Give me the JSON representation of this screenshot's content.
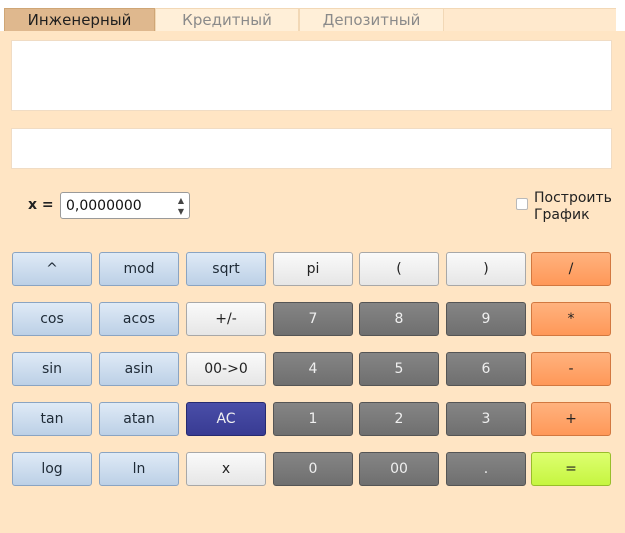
{
  "tabs": [
    {
      "label": "Инженерный",
      "active": true
    },
    {
      "label": "Кредитный",
      "active": false
    },
    {
      "label": "Депозитный",
      "active": false
    }
  ],
  "display": {
    "expression": "",
    "result": ""
  },
  "x_input": {
    "label": "x =",
    "value": "0,0000000"
  },
  "graph_checkbox": {
    "label_line1": "Построить",
    "label_line2": "График",
    "checked": false
  },
  "keys": [
    [
      "^",
      "mod",
      "sqrt",
      "pi",
      "(",
      ")",
      "/"
    ],
    [
      "cos",
      "acos",
      "+/-",
      "7",
      "8",
      "9",
      "*"
    ],
    [
      "sin",
      "asin",
      "00->0",
      "4",
      "5",
      "6",
      "-"
    ],
    [
      "tan",
      "atan",
      "AC",
      "1",
      "2",
      "3",
      "+"
    ],
    [
      "log",
      "ln",
      "x",
      "0",
      "00",
      ".",
      "="
    ]
  ],
  "colors": {
    "background": "#ffe5c4",
    "active_tab": "#dfb88e",
    "function_key": "#c8d8ec",
    "digit_key": "#7a7a7a",
    "operator_key": "#ff9e62",
    "clear_key": "#3a3d96",
    "equals_key": "#ccff4c"
  }
}
